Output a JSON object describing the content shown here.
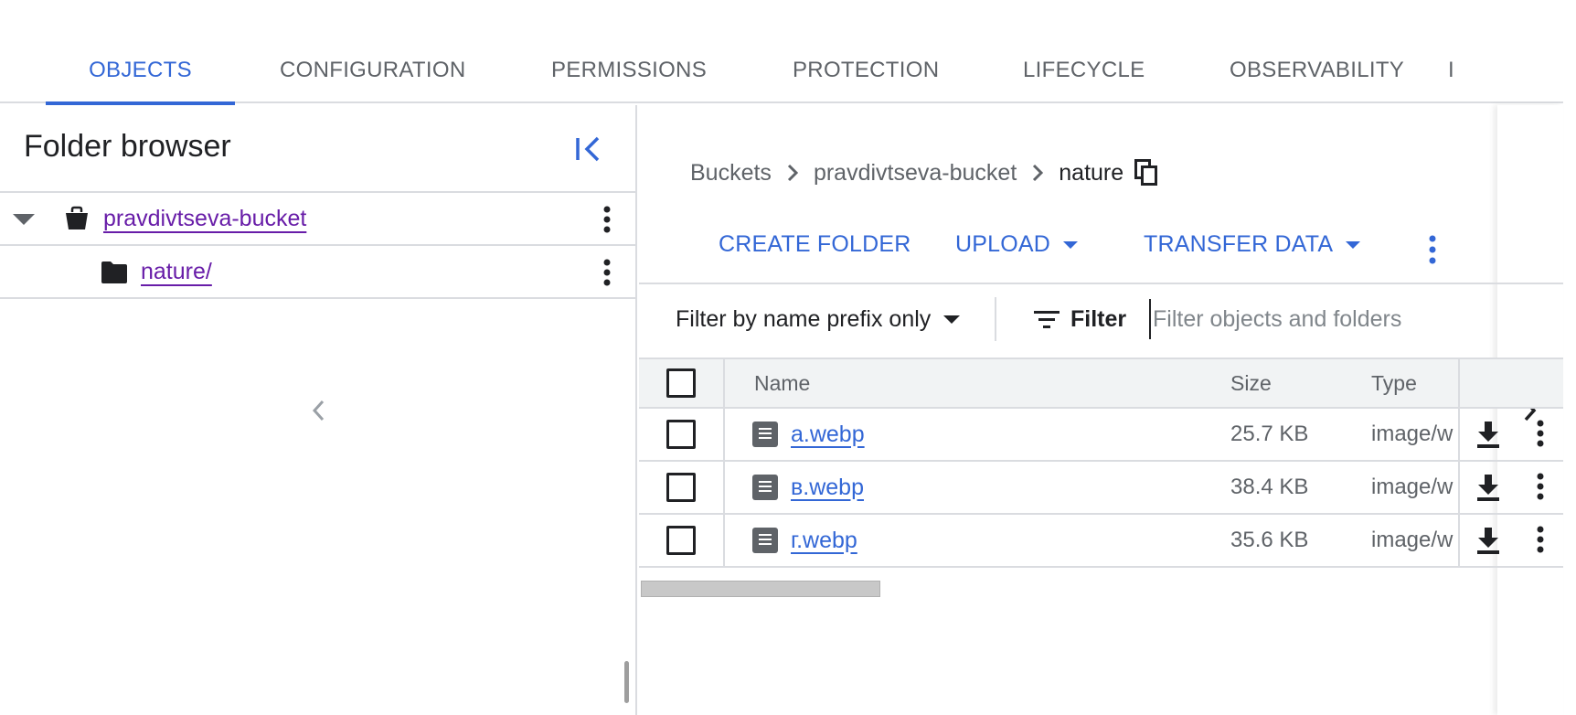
{
  "tabs": {
    "items": [
      {
        "label": "OBJECTS",
        "active": true
      },
      {
        "label": "CONFIGURATION"
      },
      {
        "label": "PERMISSIONS"
      },
      {
        "label": "PROTECTION"
      },
      {
        "label": "LIFECYCLE"
      },
      {
        "label": "OBSERVABILITY"
      },
      {
        "label": "I"
      }
    ]
  },
  "folder_browser": {
    "title": "Folder browser",
    "tree": [
      {
        "label": "pravdivtseva-bucket",
        "icon": "bucket-icon",
        "expanded": true
      },
      {
        "label": "nature/",
        "icon": "folder-icon"
      }
    ]
  },
  "breadcrumb": {
    "items": [
      "Buckets",
      "pravdivtseva-bucket",
      "nature"
    ]
  },
  "actions": {
    "create_folder": "CREATE FOLDER",
    "upload": "UPLOAD",
    "transfer_data": "TRANSFER DATA"
  },
  "filter": {
    "mode": "Filter by name prefix only",
    "button": "Filter",
    "placeholder": "Filter objects and folders"
  },
  "table": {
    "columns": [
      "Name",
      "Size",
      "Type"
    ],
    "rows": [
      {
        "name": "a.webp",
        "size": "25.7 KB",
        "type": "image/w"
      },
      {
        "name": "в.webp",
        "size": "38.4 KB",
        "type": "image/w"
      },
      {
        "name": "г.webp",
        "size": "35.6 KB",
        "type": "image/w"
      }
    ]
  },
  "colors": {
    "accent": "#3367d6",
    "visited_link": "#681da8",
    "divider": "#dadce0"
  }
}
